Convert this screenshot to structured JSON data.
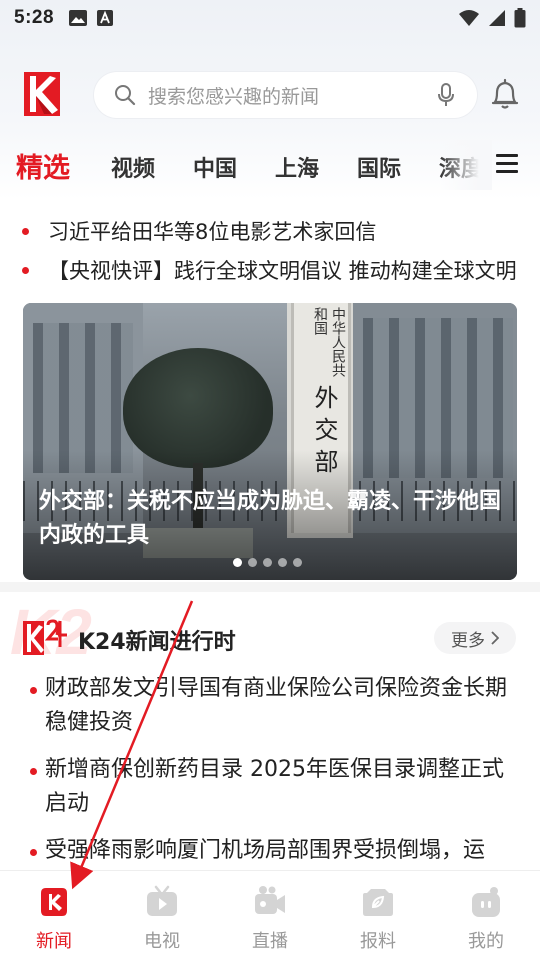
{
  "status_bar": {
    "time": "5:28"
  },
  "header": {
    "search_placeholder": "搜索您感兴趣的新闻"
  },
  "tabs": [
    {
      "label": "精选",
      "active": true
    },
    {
      "label": "视频"
    },
    {
      "label": "中国"
    },
    {
      "label": "上海"
    },
    {
      "label": "国际"
    },
    {
      "label": "深度"
    }
  ],
  "top_headlines": [
    "习近平给田华等8位电影艺术家回信",
    "【央视快评】践行全球文明倡议 推动构建全球文明"
  ],
  "banner": {
    "sign_small": "中华人民共和国",
    "sign_large": "外交部",
    "caption": "外交部：关税不应当成为胁迫、霸凌、干涉他国内政的工具",
    "slide_count": 5,
    "active_slide": 1
  },
  "k24": {
    "title": "K24新闻进行时",
    "more_label": "更多",
    "items": [
      "财政部发文引导国有商业保险公司保险资金长期稳健投资",
      "新增商保创新药目录 2025年医保目录调整正式启动",
      "受强降雨影响厦门机场局部围界受损倒塌，运"
    ]
  },
  "bottom_nav": [
    {
      "label": "新闻",
      "icon": "news-icon",
      "active": true
    },
    {
      "label": "电视",
      "icon": "tv-icon"
    },
    {
      "label": "直播",
      "icon": "live-camera-icon"
    },
    {
      "label": "报料",
      "icon": "report-icon"
    },
    {
      "label": "我的",
      "icon": "profile-icon"
    }
  ],
  "colors": {
    "accent": "#e31b23"
  }
}
